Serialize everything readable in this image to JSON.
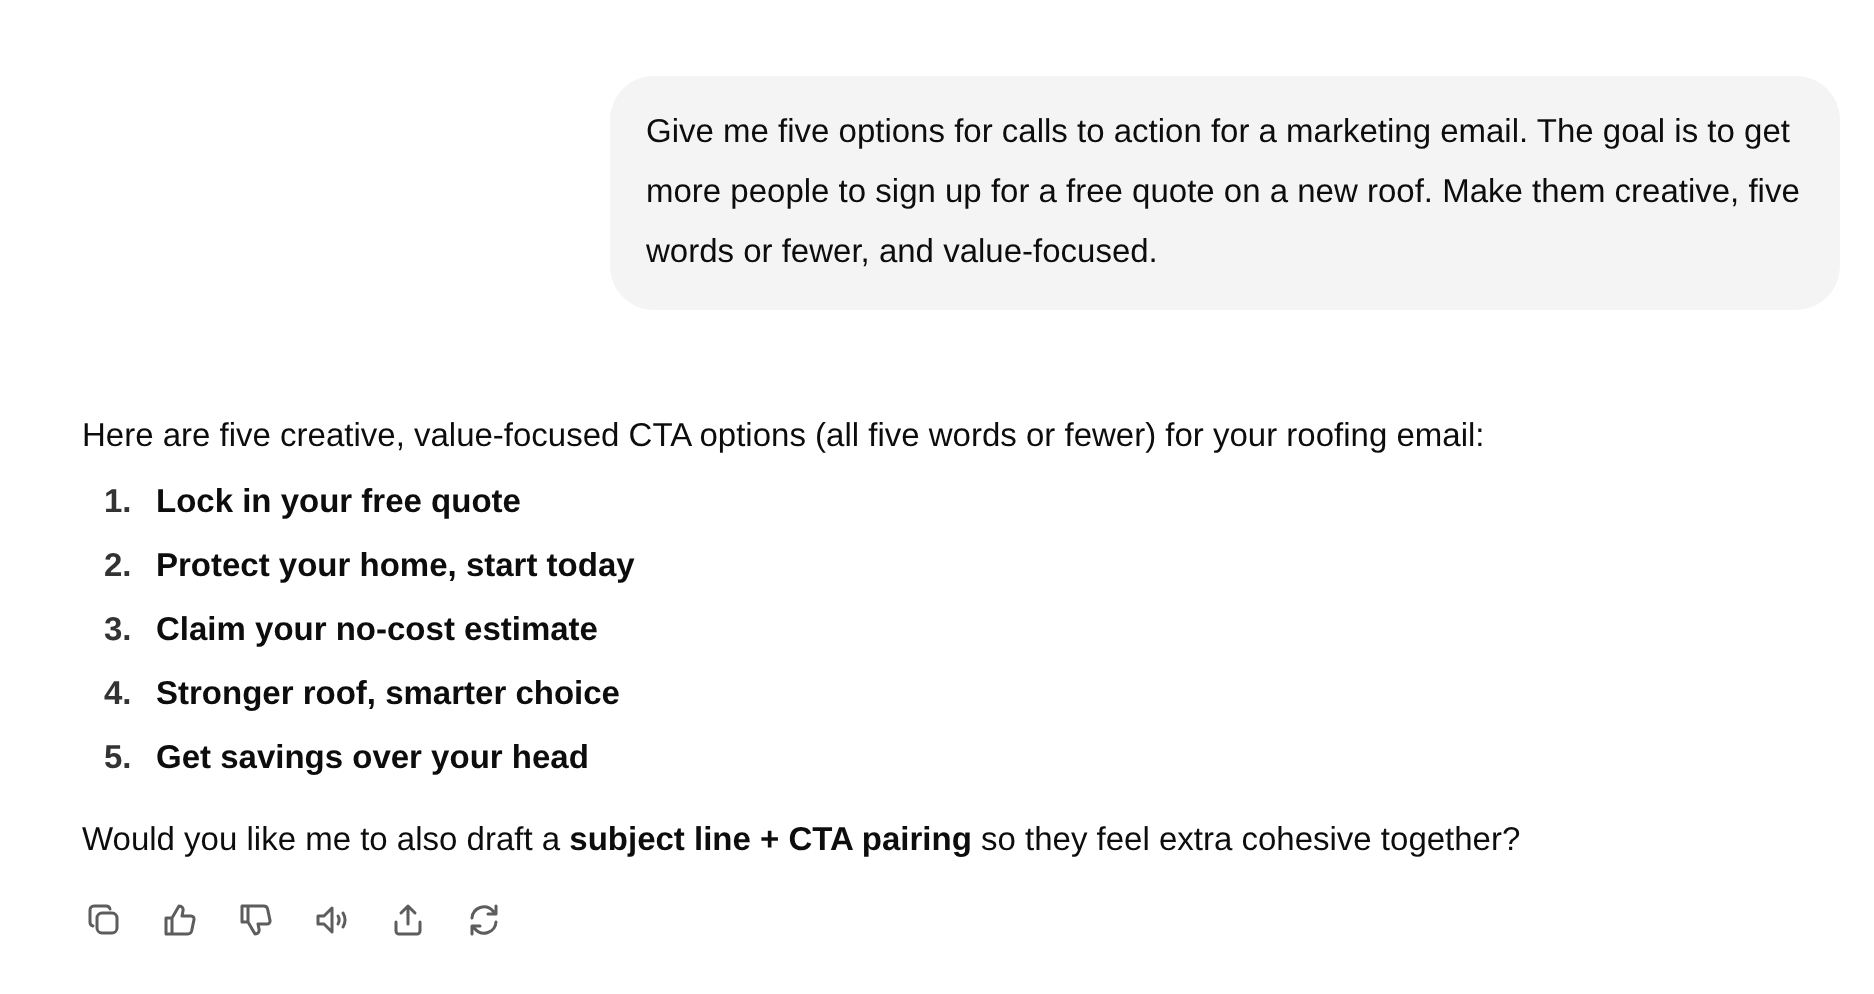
{
  "user_message": "Give me five options for calls to action for a marketing email. The goal is to get more people to sign up for a free quote on a new roof. Make them creative, five words or fewer, and value-focused.",
  "response": {
    "intro": "Here are five creative, value-focused CTA options (all five words or fewer) for your roofing email:",
    "options": [
      {
        "number": "1.",
        "text": "Lock in your free quote"
      },
      {
        "number": "2.",
        "text": "Protect your home, start today"
      },
      {
        "number": "3.",
        "text": "Claim your no-cost estimate"
      },
      {
        "number": "4.",
        "text": "Stronger roof, smarter choice"
      },
      {
        "number": "5.",
        "text": "Get savings over your head"
      }
    ],
    "closing": "Would you like me to also draft a **subject line + CTA pairing** so they feel extra cohesive together?"
  },
  "actions": [
    {
      "kind": "copy"
    },
    {
      "kind": "like"
    },
    {
      "kind": "dislike"
    },
    {
      "kind": "read-aloud"
    },
    {
      "kind": "share"
    },
    {
      "kind": "regenerate"
    }
  ]
}
